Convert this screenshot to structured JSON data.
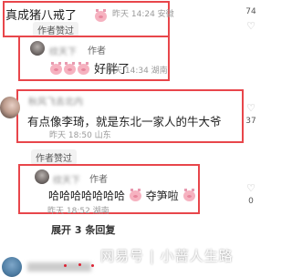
{
  "comment1": {
    "text": "真成猪八戒了",
    "meta": "昨天 14:24 安徽",
    "liked_badge": "作者赞过",
    "like_count": "74"
  },
  "reply1": {
    "username": "纹天下",
    "author_tag": "作者",
    "text": "好胖了",
    "meta": "昨天 14:34 湖南"
  },
  "comment2": {
    "username": "秋风飞去北内",
    "text": "有点像李琦，就是东北一家人的牛大爷",
    "meta": "昨天 18:50 山东",
    "liked_badge": "作者赞过",
    "like_count": "37"
  },
  "reply2": {
    "username": "纹天下",
    "author_tag": "作者",
    "text_a": "哈哈哈哈哈哈哈",
    "text_b": "夺笋啦",
    "meta": "昨天 18:52 湖南",
    "like_count": "0"
  },
  "expand_replies": "展开 3 条回复",
  "watermark": "网易号 | 小蔷人生路",
  "icons": {
    "like": "heart-outline-icon",
    "emoji": "pig-face-emoji"
  },
  "colors": {
    "highlight_border": "#e8464b",
    "meta_text": "#9a9a9a"
  }
}
